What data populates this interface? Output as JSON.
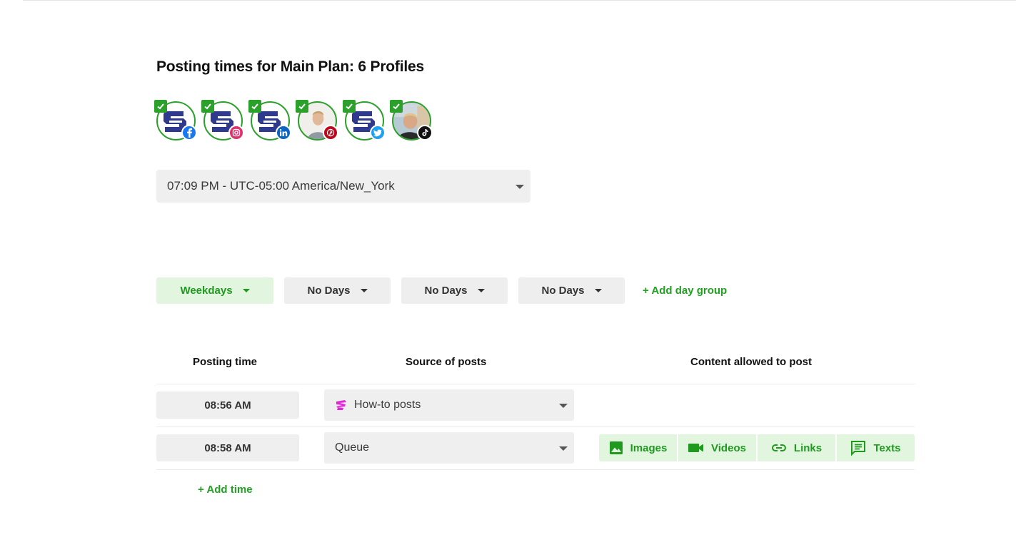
{
  "title": {
    "prefix": "Posting times for ",
    "plan": "Main Plan: 6 Profiles"
  },
  "profiles": [
    {
      "avatar": "brand-logo",
      "network": "facebook",
      "network_color": "#1877f2",
      "selected": true
    },
    {
      "avatar": "brand-logo",
      "network": "instagram",
      "network_color": "#e1306c",
      "selected": true
    },
    {
      "avatar": "brand-logo",
      "network": "linkedin",
      "network_color": "#0a66c2",
      "selected": true
    },
    {
      "avatar": "person-photo",
      "network": "pinterest",
      "network_color": "#bd081c",
      "selected": true
    },
    {
      "avatar": "brand-logo",
      "network": "twitter",
      "network_color": "#1da1f2",
      "selected": true
    },
    {
      "avatar": "person-photo",
      "network": "tiktok",
      "network_color": "#111111",
      "selected": true
    }
  ],
  "timezone": {
    "value": "07:09 PM - UTC-05:00 America/New_York"
  },
  "day_groups": [
    {
      "label": "Weekdays",
      "active": true
    },
    {
      "label": "No Days",
      "active": false
    },
    {
      "label": "No Days",
      "active": false
    },
    {
      "label": "No Days",
      "active": false
    }
  ],
  "add_day_group": "+ Add day group",
  "table": {
    "headers": {
      "time": "Posting time",
      "source": "Source of posts",
      "content": "Content allowed to post"
    },
    "rows": [
      {
        "time": "08:56 AM",
        "source": "How-to posts",
        "source_icon": "category-tag-icon",
        "source_icon_color": "#e02ad6",
        "content": []
      },
      {
        "time": "08:58 AM",
        "source": "Queue",
        "content": [
          "Images",
          "Videos",
          "Links",
          "Texts"
        ]
      }
    ]
  },
  "add_time": "+ Add time",
  "colors": {
    "accent": "#22a022",
    "accent_bg": "#e1f5df",
    "field_bg": "#efefef",
    "brand_logo": "#2f3a8f"
  }
}
